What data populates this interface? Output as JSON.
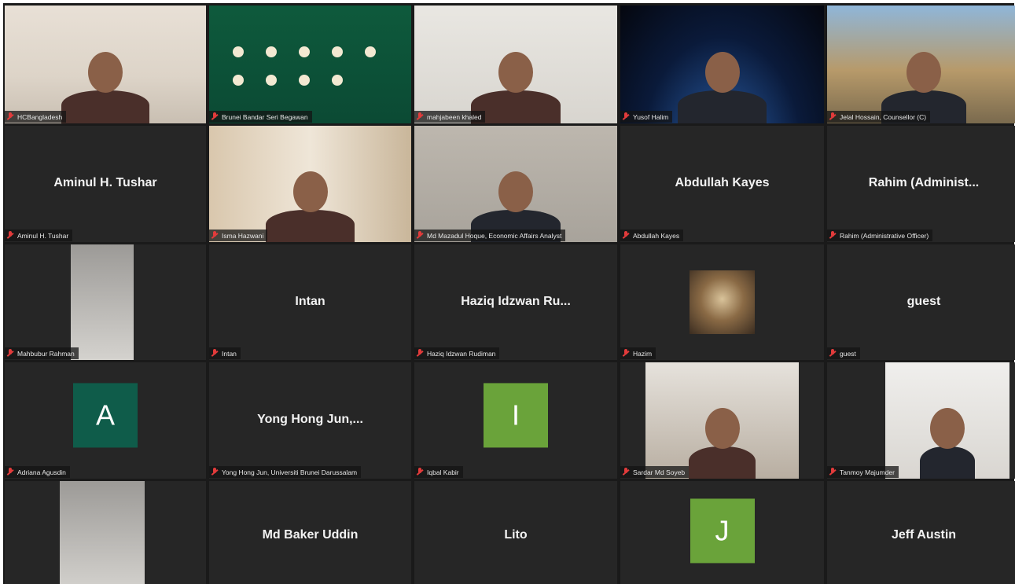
{
  "participants": [
    {
      "name": "HCBangladesh",
      "type": "video"
    },
    {
      "name": "Brunei Bandar Seri Begawan",
      "type": "video"
    },
    {
      "name": "mahjabeen khaled",
      "type": "video"
    },
    {
      "name": "Yusof Halim",
      "type": "video"
    },
    {
      "name": "Jelal Hossain, Counsellor (C)",
      "type": "video",
      "active": true
    },
    {
      "name": "Aminul H. Tushar",
      "display": "Aminul H. Tushar",
      "type": "name"
    },
    {
      "name": "Isma Hazwani",
      "type": "video"
    },
    {
      "name": "Md Mazadul Hoque, Economic Affairs Analyst",
      "type": "video"
    },
    {
      "name": "Abdullah Kayes",
      "display": "Abdullah Kayes",
      "type": "name"
    },
    {
      "name": "Rahim (Administrative Officer)",
      "display": "Rahim  (Administ...",
      "type": "name"
    },
    {
      "name": "Mahbubur Rahman",
      "type": "video"
    },
    {
      "name": "Intan",
      "display": "Intan",
      "type": "name"
    },
    {
      "name": "Haziq Idzwan Rudiman",
      "display": "Haziq Idzwan Ru...",
      "type": "name"
    },
    {
      "name": "Hazim",
      "type": "image"
    },
    {
      "name": "guest",
      "display": "guest",
      "type": "name"
    },
    {
      "name": "Adriana Agusdin",
      "type": "avatar",
      "initial": "A",
      "color": "#0f5c4a"
    },
    {
      "name": "Yong Hong Jun, Universiti Brunei Darussalam",
      "display": "Yong  Hong  Jun,...",
      "type": "name"
    },
    {
      "name": "Iqbal Kabir",
      "type": "avatar",
      "initial": "I",
      "color": "#6aa33a"
    },
    {
      "name": "Sardar Md Soyeb",
      "type": "video"
    },
    {
      "name": "Tanmoy Majumder",
      "type": "video"
    },
    {
      "name": "",
      "type": "video"
    },
    {
      "name": "",
      "display": "Md Baker Uddin",
      "type": "name"
    },
    {
      "name": "",
      "display": "Lito",
      "type": "name"
    },
    {
      "name": "",
      "type": "avatar",
      "initial": "J",
      "color": "#6aa33a"
    },
    {
      "name": "",
      "display": "Jeff Austin",
      "type": "name"
    }
  ],
  "colors": {
    "tile": "#262626",
    "background": "#1a1a1a",
    "active_border": "#c9d36a",
    "mic_muted": "#e23b3b"
  }
}
